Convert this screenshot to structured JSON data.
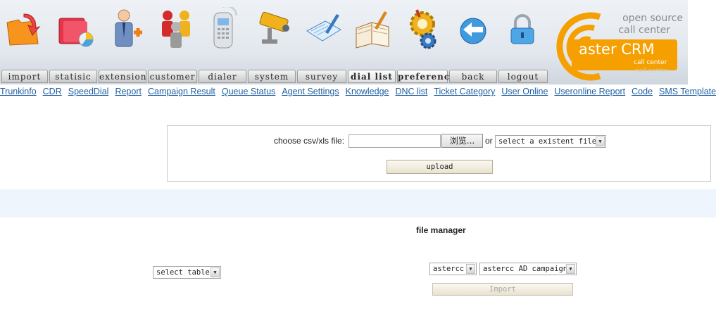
{
  "header": {
    "tabs": [
      {
        "label": "import"
      },
      {
        "label": "statisic"
      },
      {
        "label": "extension"
      },
      {
        "label": "customer"
      },
      {
        "label": "dialer"
      },
      {
        "label": "system"
      },
      {
        "label": "survey"
      },
      {
        "label": "dial list"
      },
      {
        "label": "preference"
      },
      {
        "label": "back"
      },
      {
        "label": "logout"
      }
    ],
    "icons": [
      "folder-arrow-icon",
      "folders-chart-icon",
      "person-add-icon",
      "people-group-icon",
      "phone-icon",
      "security-camera-icon",
      "notepad-icon",
      "book-icon",
      "gears-icon",
      "back-globe-icon",
      "lock-icon"
    ],
    "logo": {
      "tagline_line1": "open source",
      "tagline_line2": "call center",
      "brand": "aster CRM",
      "sub": "call center",
      "sub_reflection": "call center"
    }
  },
  "nav_links": [
    "Trunkinfo",
    "CDR",
    "SpeedDial",
    "Report",
    "Campaign Result",
    "Queue Status",
    "Agent Settings",
    "Knowledge",
    "DNC list",
    "Ticket Category",
    "User Online",
    "Useronline Report",
    "Code",
    "SMS Templates"
  ],
  "upload": {
    "file_label": "choose csv/xls file:",
    "file_value": "",
    "browse_label": "浏览...",
    "or_label": "or",
    "existing_file_select": "select a existent file",
    "upload_button": "upload"
  },
  "file_manager": {
    "title": "file manager",
    "table_select": "select table",
    "group_select": "astercc",
    "campaign_select": "astercc AD campaign",
    "import_button": "Import"
  },
  "colors": {
    "link": "#1f5fa0",
    "logo_orange": "#f5a000",
    "band": "#eef5fd"
  }
}
